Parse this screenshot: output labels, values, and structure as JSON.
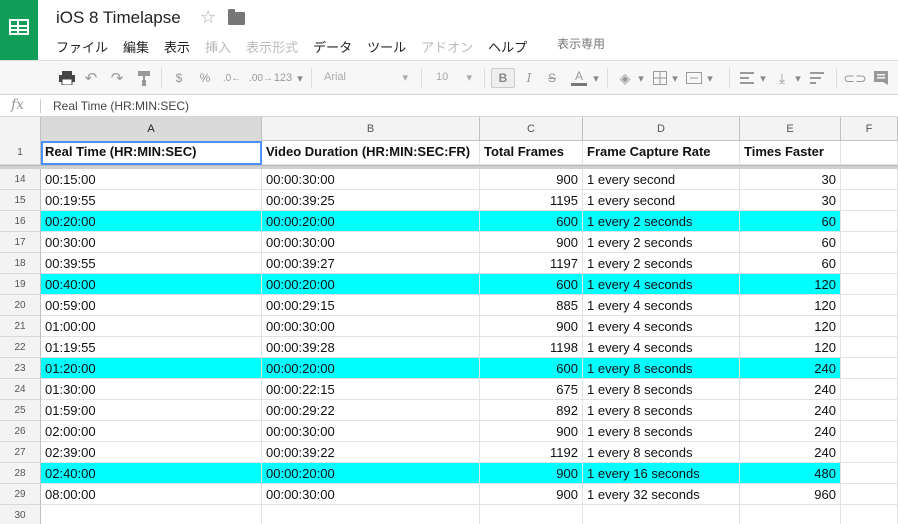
{
  "header": {
    "title": "iOS 8 Timelapse",
    "view_only": "表示専用"
  },
  "menu": [
    {
      "label": "ファイル",
      "disabled": false
    },
    {
      "label": "編集",
      "disabled": false
    },
    {
      "label": "表示",
      "disabled": false
    },
    {
      "label": "挿入",
      "disabled": true
    },
    {
      "label": "表示形式",
      "disabled": true
    },
    {
      "label": "データ",
      "disabled": false
    },
    {
      "label": "ツール",
      "disabled": false
    },
    {
      "label": "アドオン",
      "disabled": true
    },
    {
      "label": "ヘルプ",
      "disabled": false
    }
  ],
  "toolbar": {
    "currency": "$",
    "percent": "%",
    "dec_decrease": ".0←",
    "dec_increase": ".00→",
    "more_formats": "123",
    "font": "Arial",
    "font_size": "10",
    "bold": "B",
    "italic": "I",
    "strike": "S",
    "text_color": "A"
  },
  "formula_bar": {
    "fx": "fx",
    "content": "Real Time (HR:MIN:SEC)"
  },
  "columns": [
    "A",
    "B",
    "C",
    "D",
    "E",
    "F"
  ],
  "rows": [
    {
      "n": "1",
      "hl": false,
      "header": true,
      "cells": [
        "Real Time (HR:MIN:SEC)",
        "Video Duration (HR:MIN:SEC:FR)",
        "Total Frames",
        "Frame Capture Rate",
        "Times Faster"
      ]
    },
    {
      "n": "14",
      "hl": false,
      "cells": [
        "00:15:00",
        "00:00:30:00",
        "900",
        "1 every second",
        "30"
      ]
    },
    {
      "n": "15",
      "hl": false,
      "cells": [
        "00:19:55",
        "00:00:39:25",
        "1195",
        "1 every second",
        "30"
      ]
    },
    {
      "n": "16",
      "hl": true,
      "cells": [
        "00:20:00",
        "00:00:20:00",
        "600",
        "1 every 2 seconds",
        "60"
      ]
    },
    {
      "n": "17",
      "hl": false,
      "cells": [
        "00:30:00",
        "00:00:30:00",
        "900",
        "1 every 2 seconds",
        "60"
      ]
    },
    {
      "n": "18",
      "hl": false,
      "cells": [
        "00:39:55",
        "00:00:39:27",
        "1197",
        "1 every 2 seconds",
        "60"
      ]
    },
    {
      "n": "19",
      "hl": true,
      "cells": [
        "00:40:00",
        "00:00:20:00",
        "600",
        "1 every 4 seconds",
        "120"
      ]
    },
    {
      "n": "20",
      "hl": false,
      "cells": [
        "00:59:00",
        "00:00:29:15",
        "885",
        "1 every 4 seconds",
        "120"
      ]
    },
    {
      "n": "21",
      "hl": false,
      "cells": [
        "01:00:00",
        "00:00:30:00",
        "900",
        "1 every 4 seconds",
        "120"
      ]
    },
    {
      "n": "22",
      "hl": false,
      "cells": [
        "01:19:55",
        "00:00:39:28",
        "1198",
        "1 every 4 seconds",
        "120"
      ]
    },
    {
      "n": "23",
      "hl": true,
      "cells": [
        "01:20:00",
        "00:00:20:00",
        "600",
        "1 every 8 seconds",
        "240"
      ]
    },
    {
      "n": "24",
      "hl": false,
      "cells": [
        "01:30:00",
        "00:00:22:15",
        "675",
        "1 every 8 seconds",
        "240"
      ]
    },
    {
      "n": "25",
      "hl": false,
      "cells": [
        "01:59:00",
        "00:00:29:22",
        "892",
        "1 every 8 seconds",
        "240"
      ]
    },
    {
      "n": "26",
      "hl": false,
      "cells": [
        "02:00:00",
        "00:00:30:00",
        "900",
        "1 every 8 seconds",
        "240"
      ]
    },
    {
      "n": "27",
      "hl": false,
      "cells": [
        "02:39:00",
        "00:00:39:22",
        "1192",
        "1 every 8 seconds",
        "240"
      ]
    },
    {
      "n": "28",
      "hl": true,
      "cells": [
        "02:40:00",
        "00:00:20:00",
        "900",
        "1 every 16 seconds",
        "480"
      ]
    },
    {
      "n": "29",
      "hl": false,
      "cells": [
        "08:00:00",
        "00:00:30:00",
        "900",
        "1 every 32 seconds",
        "960"
      ]
    },
    {
      "n": "30",
      "hl": false,
      "cells": [
        "",
        "",
        "",
        "",
        ""
      ]
    }
  ],
  "colors": {
    "highlight": "#00ffff",
    "brand": "#0f9d58",
    "selection": "#4d90fe"
  }
}
